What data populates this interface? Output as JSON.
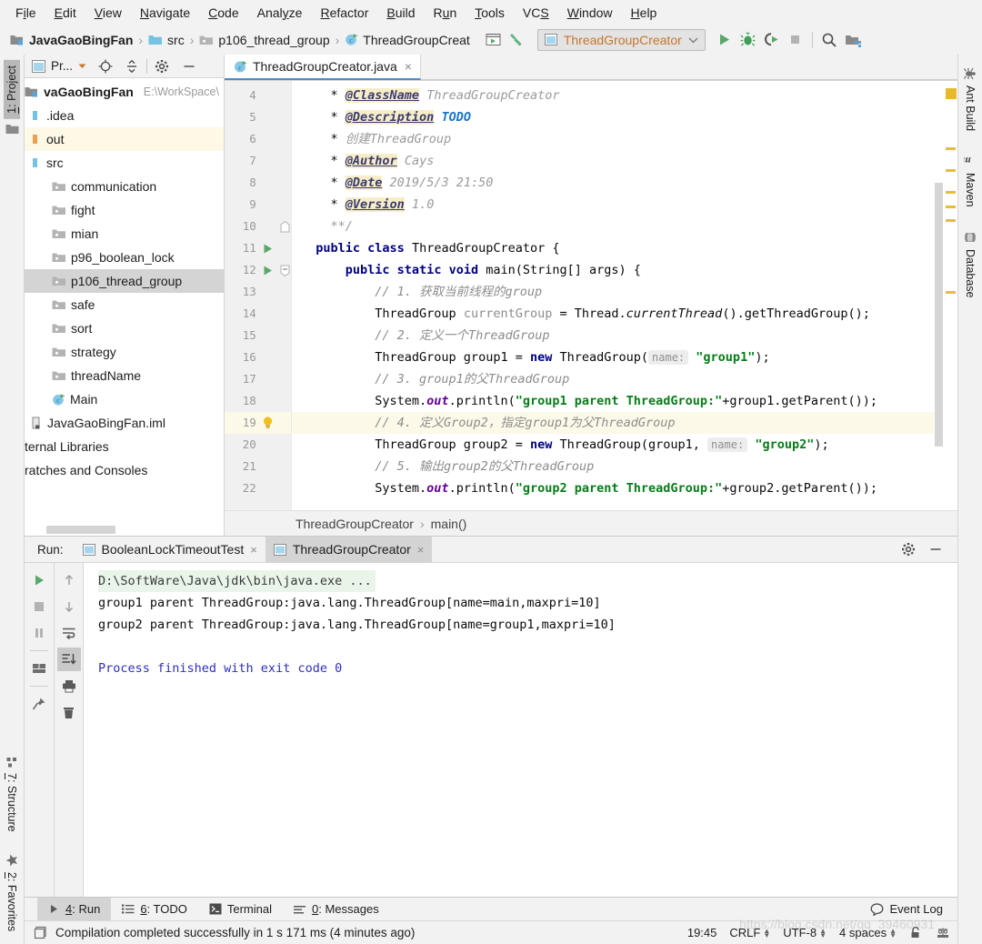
{
  "menubar": {
    "items": [
      {
        "pre": "F",
        "mn": "i",
        "post": "le"
      },
      {
        "pre": "",
        "mn": "E",
        "post": "dit"
      },
      {
        "pre": "",
        "mn": "V",
        "post": "iew"
      },
      {
        "pre": "",
        "mn": "N",
        "post": "avigate"
      },
      {
        "pre": "",
        "mn": "C",
        "post": "ode"
      },
      {
        "pre": "Anal",
        "mn": "y",
        "post": "ze"
      },
      {
        "pre": "",
        "mn": "R",
        "post": "efactor"
      },
      {
        "pre": "",
        "mn": "B",
        "post": "uild"
      },
      {
        "pre": "R",
        "mn": "u",
        "post": "n"
      },
      {
        "pre": "",
        "mn": "T",
        "post": "ools"
      },
      {
        "pre": "VC",
        "mn": "S",
        "post": ""
      },
      {
        "pre": "",
        "mn": "W",
        "post": "indow"
      },
      {
        "pre": "",
        "mn": "H",
        "post": "elp"
      }
    ]
  },
  "navbar": {
    "crumbs": [
      {
        "label": "JavaGaoBingFan",
        "icon": "module-icon",
        "bold": true
      },
      {
        "label": "src",
        "icon": "source-folder-icon",
        "bold": false
      },
      {
        "label": "p106_thread_group",
        "icon": "package-folder-icon",
        "bold": false
      },
      {
        "label": "ThreadGroupCreat",
        "icon": "java-class-icon",
        "bold": false
      }
    ],
    "run_configuration": "ThreadGroupCreator",
    "buttons": [
      "run-button",
      "debug-button",
      "run-with-coverage-button",
      "stop-button",
      "search-everywhere-button",
      "project-structure-button"
    ]
  },
  "left_rail": {
    "top_tab": {
      "pre": "",
      "mn": "1",
      "post": ": Project"
    },
    "bottom_tabs": [
      {
        "pre": "",
        "mn": "7",
        "post": ": Structure"
      },
      {
        "pre": "",
        "mn": "2",
        "post": ": Favorites"
      }
    ]
  },
  "right_rail": {
    "tabs": [
      "Ant Build",
      "Maven",
      "Database"
    ]
  },
  "project_panel": {
    "title": "Pr...",
    "header_buttons": [
      "locate-icon",
      "collapse-all-icon",
      "settings-gear-icon",
      "hide-icon"
    ],
    "tree": [
      {
        "label": "vaGaoBingFan",
        "icon": "module-icon",
        "indent": 0,
        "bold": true,
        "state": "none",
        "hint": "E:\\WorkSpace\\"
      },
      {
        "label": ".idea",
        "icon": "folder-blue-icon",
        "indent": 1,
        "bold": false,
        "state": "none",
        "hint": ""
      },
      {
        "label": "out",
        "icon": "folder-orange-icon",
        "indent": 1,
        "bold": false,
        "state": "highlight",
        "hint": ""
      },
      {
        "label": "src",
        "icon": "folder-blue-icon",
        "indent": 1,
        "bold": false,
        "state": "none",
        "hint": ""
      },
      {
        "label": "communication",
        "icon": "package-folder-icon",
        "indent": 2,
        "bold": false,
        "state": "none",
        "hint": ""
      },
      {
        "label": "fight",
        "icon": "package-folder-icon",
        "indent": 2,
        "bold": false,
        "state": "none",
        "hint": ""
      },
      {
        "label": "mian",
        "icon": "package-folder-icon",
        "indent": 2,
        "bold": false,
        "state": "none",
        "hint": ""
      },
      {
        "label": "p96_boolean_lock",
        "icon": "package-folder-icon",
        "indent": 2,
        "bold": false,
        "state": "none",
        "hint": ""
      },
      {
        "label": "p106_thread_group",
        "icon": "package-folder-icon",
        "indent": 2,
        "bold": false,
        "state": "selected",
        "hint": ""
      },
      {
        "label": "safe",
        "icon": "package-folder-icon",
        "indent": 2,
        "bold": false,
        "state": "none",
        "hint": ""
      },
      {
        "label": "sort",
        "icon": "package-folder-icon",
        "indent": 2,
        "bold": false,
        "state": "none",
        "hint": ""
      },
      {
        "label": "strategy",
        "icon": "package-folder-icon",
        "indent": 2,
        "bold": false,
        "state": "none",
        "hint": ""
      },
      {
        "label": "threadName",
        "icon": "package-folder-icon",
        "indent": 2,
        "bold": false,
        "state": "none",
        "hint": ""
      },
      {
        "label": "Main",
        "icon": "java-class-icon",
        "indent": 2,
        "bold": false,
        "state": "none",
        "hint": ""
      },
      {
        "label": "JavaGaoBingFan.iml",
        "icon": "iml-file-icon",
        "indent": 1,
        "bold": false,
        "state": "none",
        "hint": ""
      },
      {
        "label": "ternal Libraries",
        "icon": "none",
        "indent": 0,
        "bold": false,
        "state": "none",
        "hint": ""
      },
      {
        "label": "ratches and Consoles",
        "icon": "none",
        "indent": 0,
        "bold": false,
        "state": "none",
        "hint": ""
      }
    ]
  },
  "editor": {
    "tab": {
      "label": "ThreadGroupCreator.java",
      "icon": "java-class-icon",
      "close": "×"
    },
    "first_line_number": 4,
    "caret_line": 19,
    "lines": [
      {
        "n": 4,
        "mark": "none",
        "fold": "none",
        "html": "    * <span class=\"jdtag\">@ClassName</span><span class=\"jd\"> ThreadGroupCreator</span>"
      },
      {
        "n": 5,
        "mark": "none",
        "fold": "none",
        "html": "    * <span class=\"jdtag\">@Description</span><span class=\"jd\"> </span><span class=\"todo\">TODO</span>"
      },
      {
        "n": 6,
        "mark": "none",
        "fold": "none",
        "html": "    * <span class=\"jd\">创建ThreadGroup</span>"
      },
      {
        "n": 7,
        "mark": "none",
        "fold": "none",
        "html": "    * <span class=\"jdtag\">@Author</span><span class=\"jd\"> Cays</span>"
      },
      {
        "n": 8,
        "mark": "none",
        "fold": "none",
        "html": "    * <span class=\"jdtag\">@Date</span><span class=\"jd\"> 2019/5/3 21:50</span>"
      },
      {
        "n": 9,
        "mark": "none",
        "fold": "none",
        "html": "    * <span class=\"jdtag\">@Version</span><span class=\"jd\"> 1.0</span>"
      },
      {
        "n": 10,
        "mark": "none",
        "fold": "end",
        "html": "    <span class=\"jd\">**/</span>"
      },
      {
        "n": 11,
        "mark": "run",
        "fold": "none",
        "html": "  <span class=\"kw\">public class</span> ThreadGroupCreator {"
      },
      {
        "n": 12,
        "mark": "run",
        "fold": "start",
        "html": "      <span class=\"kw\">public static void</span> main(String[] args) {"
      },
      {
        "n": 13,
        "mark": "none",
        "fold": "none",
        "html": "          <span class=\"cmt\">// 1. 获取当前线程的group</span>"
      },
      {
        "n": 14,
        "mark": "none",
        "fold": "none",
        "html": "          ThreadGroup <span class=\"localv\">currentGroup</span> = Thread.<span class=\"mth\">currentThread</span>().getThreadGroup();"
      },
      {
        "n": 15,
        "mark": "none",
        "fold": "none",
        "html": "          <span class=\"cmt\">// 2. 定义一个ThreadGroup</span>"
      },
      {
        "n": 16,
        "mark": "none",
        "fold": "none",
        "html": "          ThreadGroup group1 = <span class=\"kw\">new</span> ThreadGroup(<span class=\"hint\">name:</span> <span class=\"str\">\"group1\"</span>);"
      },
      {
        "n": 17,
        "mark": "none",
        "fold": "none",
        "html": "          <span class=\"cmt\">// 3. group1的父ThreadGroup</span>"
      },
      {
        "n": 18,
        "mark": "none",
        "fold": "none",
        "html": "          System.<span class=\"fld\">out</span>.println(<span class=\"str\">\"group1 parent ThreadGroup:\"</span>+group1.getParent());"
      },
      {
        "n": 19,
        "mark": "bulb",
        "fold": "none",
        "html": "          <span class=\"cmt\">// 4. 定义Group2，指定group1为父ThreadGroup</span>"
      },
      {
        "n": 20,
        "mark": "none",
        "fold": "none",
        "html": "          ThreadGroup group2 = <span class=\"kw\">new</span> ThreadGroup(group1, <span class=\"hint\">name:</span> <span class=\"str\">\"group2\"</span>);"
      },
      {
        "n": 21,
        "mark": "none",
        "fold": "none",
        "html": "          <span class=\"cmt\">// 5. 输出group2的父ThreadGroup</span>"
      },
      {
        "n": 22,
        "mark": "none",
        "fold": "none",
        "html": "          System.<span class=\"fld\">out</span>.println(<span class=\"str\">\"group2 parent ThreadGroup:\"</span>+group2.getParent());"
      }
    ],
    "breadcrumbs": [
      "ThreadGroupCreator",
      "main()"
    ]
  },
  "run_panel": {
    "label": "Run:",
    "tabs": [
      {
        "label": "BooleanLockTimeoutTest",
        "active": false,
        "close": "×"
      },
      {
        "label": "ThreadGroupCreator",
        "active": true,
        "close": "×"
      }
    ],
    "header_buttons": [
      "settings-gear-icon",
      "hide-icon"
    ],
    "toolbar_left": [
      "rerun-button",
      "stop-button",
      "pause-button",
      "layout-button",
      "pin-button"
    ],
    "toolbar_right": [
      "up-arrow-button",
      "down-arrow-button",
      "soft-wrap-button",
      "scroll-to-end-button",
      "print-button",
      "clear-all-button"
    ],
    "console": [
      {
        "text": "D:\\SoftWare\\Java\\jdk\\bin\\java.exe ...",
        "style": "cmdline"
      },
      {
        "text": "group1 parent ThreadGroup:java.lang.ThreadGroup[name=main,maxpri=10]",
        "style": "normal"
      },
      {
        "text": "group2 parent ThreadGroup:java.lang.ThreadGroup[name=group1,maxpri=10]",
        "style": "normal"
      },
      {
        "text": "",
        "style": "normal"
      },
      {
        "text": "Process finished with exit code 0",
        "style": "exitline"
      }
    ]
  },
  "bottom_tabs": {
    "items": [
      {
        "pre": "",
        "mn": "4",
        "post": ": Run",
        "icon": "run-triangle-icon",
        "active": true
      },
      {
        "pre": "",
        "mn": "6",
        "post": ": TODO",
        "icon": "todo-list-icon",
        "active": false
      },
      {
        "pre": "",
        "mn": "",
        "post": "Terminal",
        "icon": "terminal-icon",
        "active": false
      },
      {
        "pre": "",
        "mn": "0",
        "post": ": Messages",
        "icon": "messages-icon",
        "active": false
      }
    ],
    "event_log": "Event Log"
  },
  "statusbar": {
    "message": "Compilation completed successfully in 1 s 171 ms (4 minutes ago)",
    "time": "19:45",
    "line_separator": "CRLF",
    "encoding": "UTF-8",
    "indent": "4 spaces",
    "lock_icon": "unlocked-icon",
    "inspection_icon": "inspections-icon",
    "watermark": "https://blog.csdn.net/qq_39460931"
  },
  "colors": {
    "accent_green": "#59a869",
    "tab_underline": "#4f8bc4",
    "selection": "#d4d4d4",
    "caret_line": "#fcf9e8",
    "marker_yellow": "#e5c037",
    "string_green": "#067d17",
    "keyword_navy": "#000080"
  }
}
